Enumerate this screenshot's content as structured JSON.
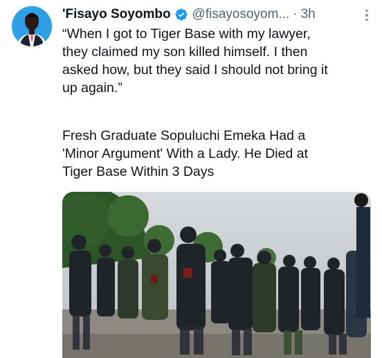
{
  "tweet": {
    "author_name": "'Fisayo Soyombo",
    "handle": "@fisayosoyom...",
    "separator": "·",
    "time": "3h",
    "quote_text": "“When I got to Tiger Base with my lawyer,\nthey claimed my son killed himself. I then\nasked how, but they said I should not bring it\nup again.”",
    "headline_text": "Fresh Graduate Sopuluchi Emeka Had a\n'Minor Argument' With a Lady. He Died at\nTiger Base Within 3 Days"
  },
  "icons": {
    "verified": "verified-badge-icon",
    "more": "more-options-icon"
  },
  "colors": {
    "verified_blue": "#1d9bf0",
    "text_primary": "#0f1419",
    "text_secondary": "#536471",
    "avatar_bg": "#2f9fe8"
  }
}
